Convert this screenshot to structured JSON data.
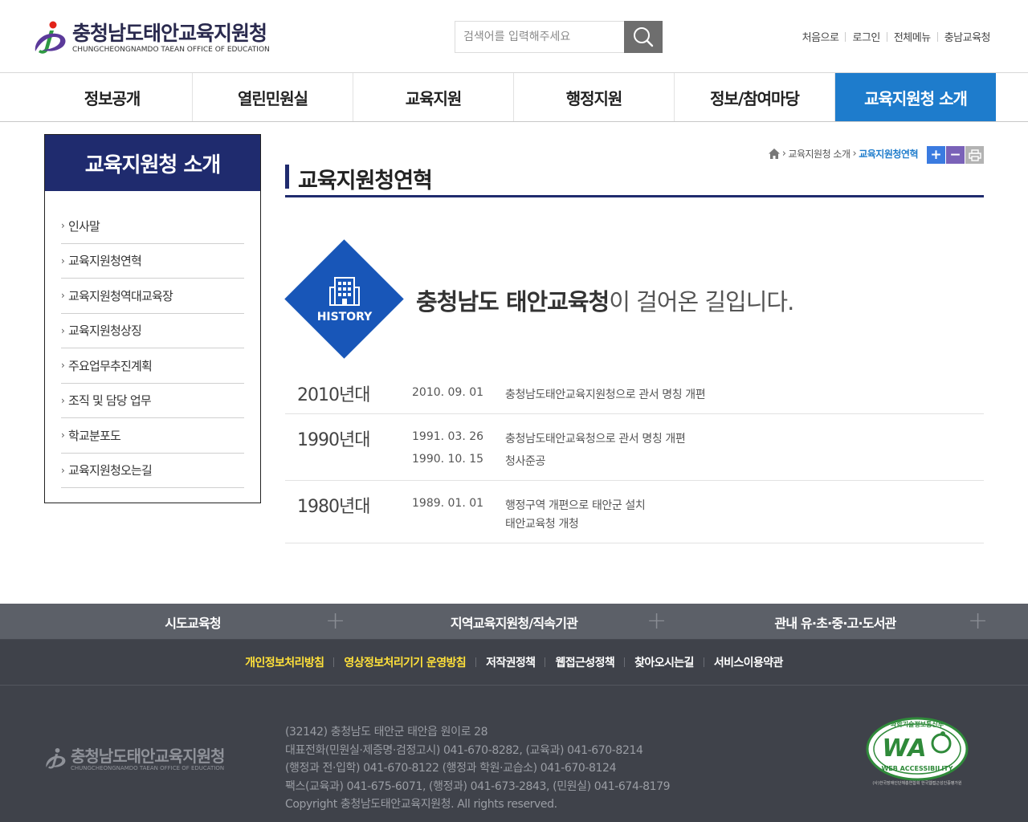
{
  "header": {
    "logo_name": "충청남도태안교육지원청",
    "logo_sub": "CHUNGCHEONGNAMDO TAEAN OFFICE OF EDUCATION",
    "search_placeholder": "검색어를 입력해주세요",
    "util_links": [
      "처음으로",
      "로그인",
      "전체메뉴",
      "충남교육청"
    ]
  },
  "gnb": {
    "items": [
      "정보공개",
      "열린민원실",
      "교육지원",
      "행정지원",
      "정보/참여마당",
      "교육지원청 소개"
    ],
    "active_index": 5
  },
  "lnb": {
    "title": "교육지원청 소개",
    "items": [
      "인사말",
      "교육지원청연혁",
      "교육지원청역대교육장",
      "교육지원청상징",
      "주요업무추진계획",
      "조직 및 담당 업무",
      "학교분포도",
      "교육지원청오는길"
    ]
  },
  "breadcrumb": {
    "items": [
      "교육지원청 소개"
    ],
    "current": "교육지원청연혁"
  },
  "page": {
    "title": "교육지원청연혁",
    "history_label": "HISTORY",
    "intro_strong": "충청남도 태안교육청",
    "intro_rest": "이 걸어온 길입니다."
  },
  "timeline": [
    {
      "era": "2010년대",
      "events": [
        {
          "date": "2010. 09. 01",
          "desc": "충청남도태안교육지원청으로 관서 명칭 개편"
        }
      ]
    },
    {
      "era": "1990년대",
      "events": [
        {
          "date": "1991. 03. 26",
          "desc": "충청남도태안교육청으로 관서 명칭 개편"
        },
        {
          "date": "1990. 10. 15",
          "desc": "청사준공"
        }
      ]
    },
    {
      "era": "1980년대",
      "events": [
        {
          "date": "1989. 01. 01",
          "desc": "행정구역 개편으로 태안군 설치"
        },
        {
          "date": "",
          "desc": "태안교육청 개청"
        }
      ]
    }
  ],
  "footer": {
    "related_links": [
      "시도교육청",
      "지역교육지원청/직속기관",
      "관내 유·초·중·고·도서관"
    ],
    "policies": [
      {
        "label": "개인정보처리방침",
        "highlight": true
      },
      {
        "label": "영상정보처리기기 운영방침",
        "highlight": true
      },
      {
        "label": "저작권정책",
        "highlight": false
      },
      {
        "label": "웹접근성정책",
        "highlight": false
      },
      {
        "label": "찾아오시는길",
        "highlight": false
      },
      {
        "label": "서비스이용약관",
        "highlight": false
      }
    ],
    "logo_name": "충청남도태안교육지원청",
    "logo_sub": "CHUNGCHEONGNAMDO TAEAN OFFICE OF EDUCATION",
    "info_lines": [
      "(32142) 충청남도 태안군 태안읍 원이로 28",
      "대표전화(민원실·제증명·검정고시) 041-670-8282, (교육과) 041-670-8214",
      "(행정과 전·입학) 041-670-8122 (행정과 학원·교습소) 041-670-8124",
      "팩스(교육과) 041-675-6071, (행정과) 041-673-2843, (민원실) 041-674-8179",
      "Copyright 충청남도태안교육지원청. All rights reserved."
    ],
    "wa_mark": {
      "top_text": "과학기술정보통신부",
      "main_text": "WA",
      "ring_text": "WEB ACCESSIBILITY",
      "bottom_text": "(사)한국장애인단체총연합회 한국웹접근성인증평가원"
    }
  },
  "colors": {
    "brand_navy": "#1f2b6e",
    "active_blue": "#1e7ccc",
    "diamond_blue": "#1856b8",
    "footer_dark": "#3f424a",
    "policy_highlight": "#ffe03a"
  }
}
